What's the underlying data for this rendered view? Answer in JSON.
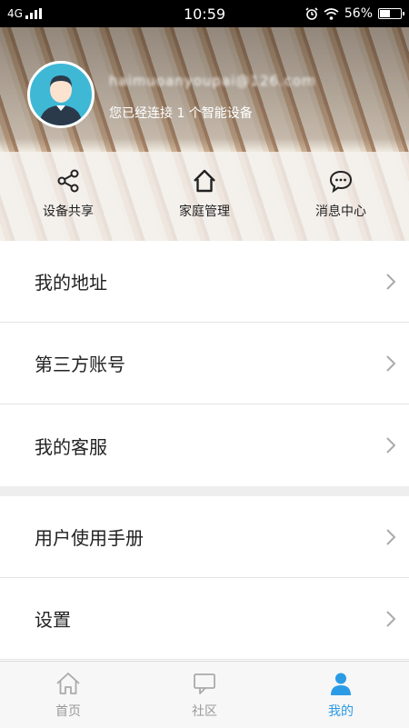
{
  "status_bar": {
    "network": "4G",
    "time": "10:59",
    "battery": "56%",
    "battery_level": 0.56
  },
  "profile": {
    "username": "haimuoanyoupai@126.com",
    "connected_text": "您已经连接 1 个智能设备"
  },
  "quick_actions": [
    {
      "label": "设备共享",
      "icon": "share-icon"
    },
    {
      "label": "家庭管理",
      "icon": "home-icon"
    },
    {
      "label": "消息中心",
      "icon": "message-icon"
    }
  ],
  "menu": {
    "address": "我的地址",
    "third_party": "第三方账号",
    "service": "我的客服",
    "manual": "用户使用手册",
    "settings": "设置"
  },
  "bottom_nav": [
    {
      "label": "首页",
      "icon": "home-icon",
      "active": false
    },
    {
      "label": "社区",
      "icon": "chat-icon",
      "active": false
    },
    {
      "label": "我的",
      "icon": "person-icon",
      "active": true
    }
  ],
  "colors": {
    "accent": "#2c9be6",
    "avatar_bg": "#3fb8d6",
    "divider": "#eeeeee"
  }
}
